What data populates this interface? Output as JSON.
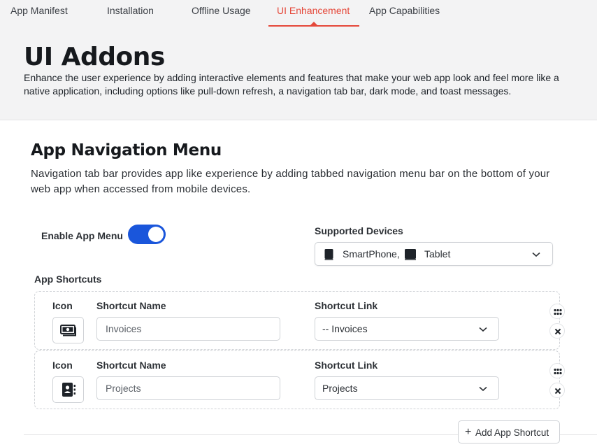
{
  "tabs": [
    {
      "label": "App Manifest"
    },
    {
      "label": "Installation"
    },
    {
      "label": "Offline Usage"
    },
    {
      "label": "UI Enhancement"
    },
    {
      "label": "App Capabilities"
    }
  ],
  "active_tab": "UI Enhancement",
  "header": {
    "title": "UI Addons",
    "description": "Enhance the user experience by adding interactive elements and features that make your web app look and feel more like a native application, including options like pull-down refresh, a navigation tab bar, dark mode, and toast messages."
  },
  "section": {
    "title": "App Navigation Menu",
    "description": "Navigation tab bar provides app like experience by adding tabbed navigation menu bar on the bottom of your web app when accessed from mobile devices."
  },
  "enable_menu": {
    "label": "Enable App Menu",
    "enabled": true
  },
  "supported_devices": {
    "label": "Supported Devices",
    "selected": [
      "SmartPhone,",
      "Tablet"
    ]
  },
  "shortcuts": {
    "label": "App Shortcuts",
    "col_icon": "Icon",
    "col_name": "Shortcut Name",
    "col_link": "Shortcut Link",
    "items": [
      {
        "icon": "money-icon",
        "name": "Invoices",
        "link": "-- Invoices"
      },
      {
        "icon": "contact-book-icon",
        "name": "Projects",
        "link": "Projects"
      }
    ],
    "add_label": "Add App Shortcut"
  },
  "colors": {
    "accent": "#e5483a",
    "toggle_on": "#1a56db"
  }
}
